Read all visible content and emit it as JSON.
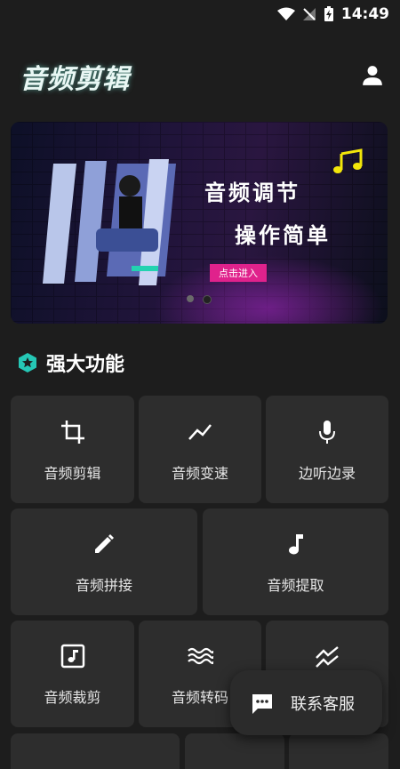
{
  "status_bar": {
    "time": "14:49"
  },
  "header": {
    "title": "音频剪辑"
  },
  "banner": {
    "line1": "音频调节",
    "line2": "操作简单",
    "cta": "点击进入"
  },
  "section": {
    "title": "强大功能"
  },
  "features": [
    {
      "label": "音频剪辑",
      "icon": "crop-icon"
    },
    {
      "label": "音频变速",
      "icon": "trend-icon"
    },
    {
      "label": "边听边录",
      "icon": "microphone-icon"
    },
    {
      "label": "音频拼接",
      "icon": "pencil-icon"
    },
    {
      "label": "音频提取",
      "icon": "music-note-icon"
    },
    {
      "label": "音频裁剪",
      "icon": "music-box-icon"
    },
    {
      "label": "音频转码",
      "icon": "waves-icon"
    },
    {
      "label": "",
      "icon": "double-trend-icon"
    }
  ],
  "contact": {
    "label": "联系客服"
  },
  "colors": {
    "accent_teal": "#25c7b5",
    "cta_pink": "#e0228c",
    "card_bg": "#2d2d2d",
    "page_bg": "#1d1d1d"
  }
}
